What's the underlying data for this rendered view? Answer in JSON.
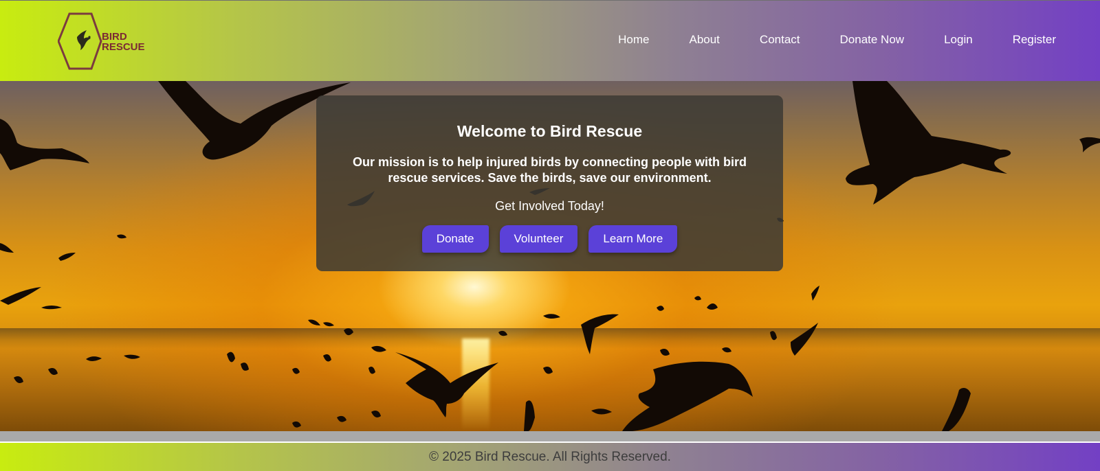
{
  "logo": {
    "line1": "BIRD",
    "line2": "RESCUE",
    "icon": "bird-hexagon-icon"
  },
  "nav": {
    "items": [
      {
        "label": "Home"
      },
      {
        "label": "About"
      },
      {
        "label": "Contact"
      },
      {
        "label": "Donate Now"
      },
      {
        "label": "Login"
      },
      {
        "label": "Register"
      }
    ]
  },
  "hero": {
    "title": "Welcome to Bird Rescue",
    "mission": "Our mission is to help injured birds by connecting people with bird rescue services. Save the birds, save our environment.",
    "cta": "Get Involved Today!",
    "buttons": {
      "donate": "Donate",
      "volunteer": "Volunteer",
      "learn_more": "Learn More"
    },
    "background": "sunset-flying-birds-photo"
  },
  "footer": {
    "text": "© 2025 Bird Rescue. All Rights Reserved."
  },
  "colors": {
    "header_gradient_start": "#c8ec10",
    "header_gradient_end": "#7340c4",
    "button": "#5b41d8",
    "panel": "#3c3a34"
  }
}
